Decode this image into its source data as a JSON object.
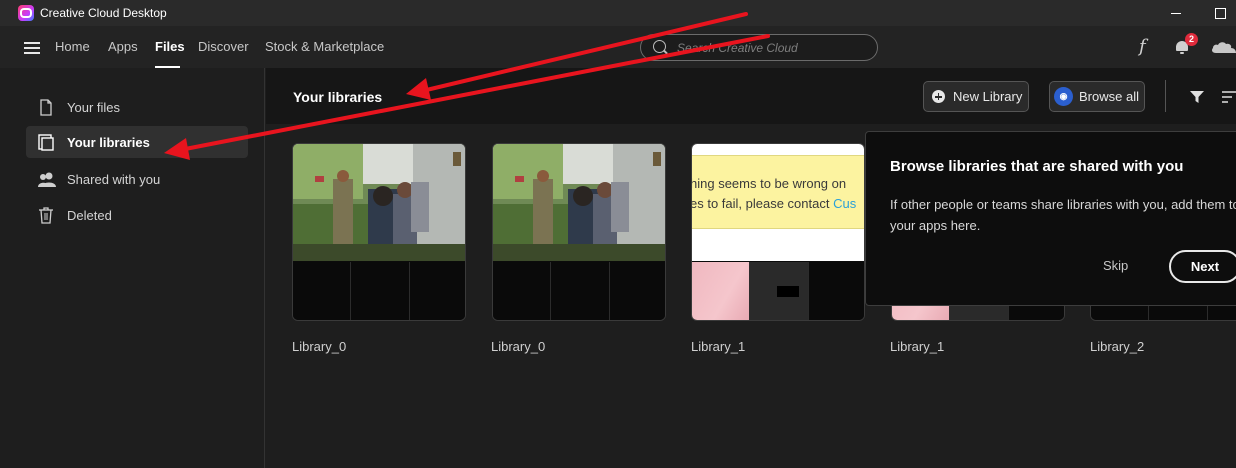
{
  "window": {
    "title": "Creative Cloud Desktop"
  },
  "nav": {
    "tabs": [
      "Home",
      "Apps",
      "Files",
      "Discover",
      "Stock & Marketplace"
    ],
    "active_tab": "Files",
    "search_placeholder": "Search Creative Cloud",
    "notification_count": "2"
  },
  "sidebar": {
    "items": [
      {
        "label": "Your files",
        "icon": "file-icon"
      },
      {
        "label": "Your libraries",
        "icon": "libraries-icon",
        "active": true
      },
      {
        "label": "Shared with you",
        "icon": "people-icon"
      },
      {
        "label": "Deleted",
        "icon": "trash-icon"
      }
    ]
  },
  "main": {
    "title": "Your libraries",
    "new_library_label": "New Library",
    "browse_all_label": "Browse all",
    "libraries": [
      {
        "name": "Library_0",
        "preview": "photo"
      },
      {
        "name": "Library_0",
        "preview": "photo"
      },
      {
        "name": "Library_1",
        "preview": "error-page"
      },
      {
        "name": "Library_1",
        "preview": "error-page"
      },
      {
        "name": "Library_2",
        "preview": "blank"
      }
    ],
    "error_preview": {
      "line1": "hing seems to be wrong on",
      "line2": "es to fail, please contact ",
      "line2_link": "Cus"
    }
  },
  "popup": {
    "title": "Browse libraries that are shared with you",
    "body_line1": "If other people or teams share libraries with you, add them to",
    "body_line2": "your apps here.",
    "skip_label": "Skip",
    "next_label": "Next"
  },
  "colors": {
    "accent_badge": "#e02b3c",
    "annotation_arrow": "#e8141e",
    "link": "#2aa0d8"
  }
}
